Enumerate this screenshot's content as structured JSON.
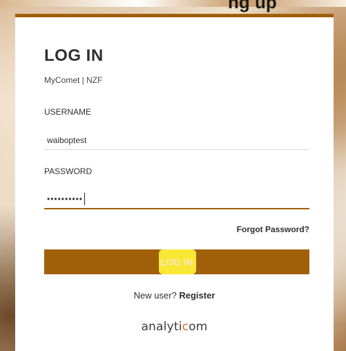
{
  "header": {
    "banner_text": "ng up"
  },
  "login_card": {
    "title": "LOG IN",
    "subtitle": "MyComet | NZF",
    "username": {
      "label": "USERNAME",
      "value": "waiboptest"
    },
    "password": {
      "label": "PASSWORD",
      "masked_value": "••••••••••"
    },
    "forgot_password_label": "Forgot Password?",
    "login_button_label": "LOG IN",
    "register_prompt": "New user? ",
    "register_link": "Register",
    "logo": {
      "text_before": "analyti",
      "accent": "c",
      "text_after": "om",
      "accent_color": "#e46a1b"
    }
  },
  "colors": {
    "brand": "#a0600a",
    "highlight": "#fff43a"
  }
}
